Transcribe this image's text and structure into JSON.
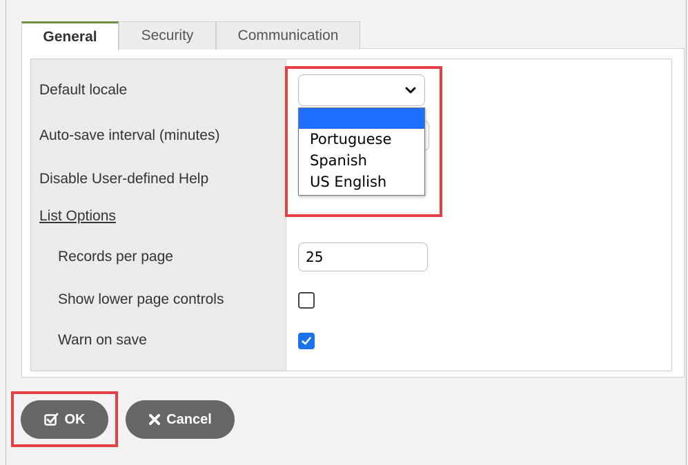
{
  "tabs": [
    {
      "label": "General",
      "active": true
    },
    {
      "label": "Security",
      "active": false
    },
    {
      "label": "Communication",
      "active": false
    }
  ],
  "fields": {
    "default_locale": {
      "label": "Default locale",
      "value": ""
    },
    "auto_save_interval": {
      "label": "Auto-save interval (minutes)"
    },
    "disable_help": {
      "label": "Disable User-defined Help"
    },
    "list_options_title": "List Options",
    "records_per_page": {
      "label": "Records per page",
      "value": "25"
    },
    "show_lower_controls": {
      "label": "Show lower page controls",
      "checked": false
    },
    "warn_on_save": {
      "label": "Warn on save",
      "checked": true
    }
  },
  "locale_dropdown": {
    "options": [
      "",
      "Portuguese",
      "Spanish",
      "US English"
    ],
    "highlighted_index": 0
  },
  "buttons": {
    "ok_label": "OK",
    "cancel_label": "Cancel"
  },
  "colors": {
    "active_tab_accent": "#6e8f3f",
    "highlight_border": "#e53f45",
    "selected_option": "#1e6fff",
    "checkbox_checked": "#1a73e8",
    "button_bg": "#666666"
  },
  "icons": {
    "ok": "check-square-icon",
    "cancel": "x-icon",
    "select": "chevron-down-icon"
  }
}
